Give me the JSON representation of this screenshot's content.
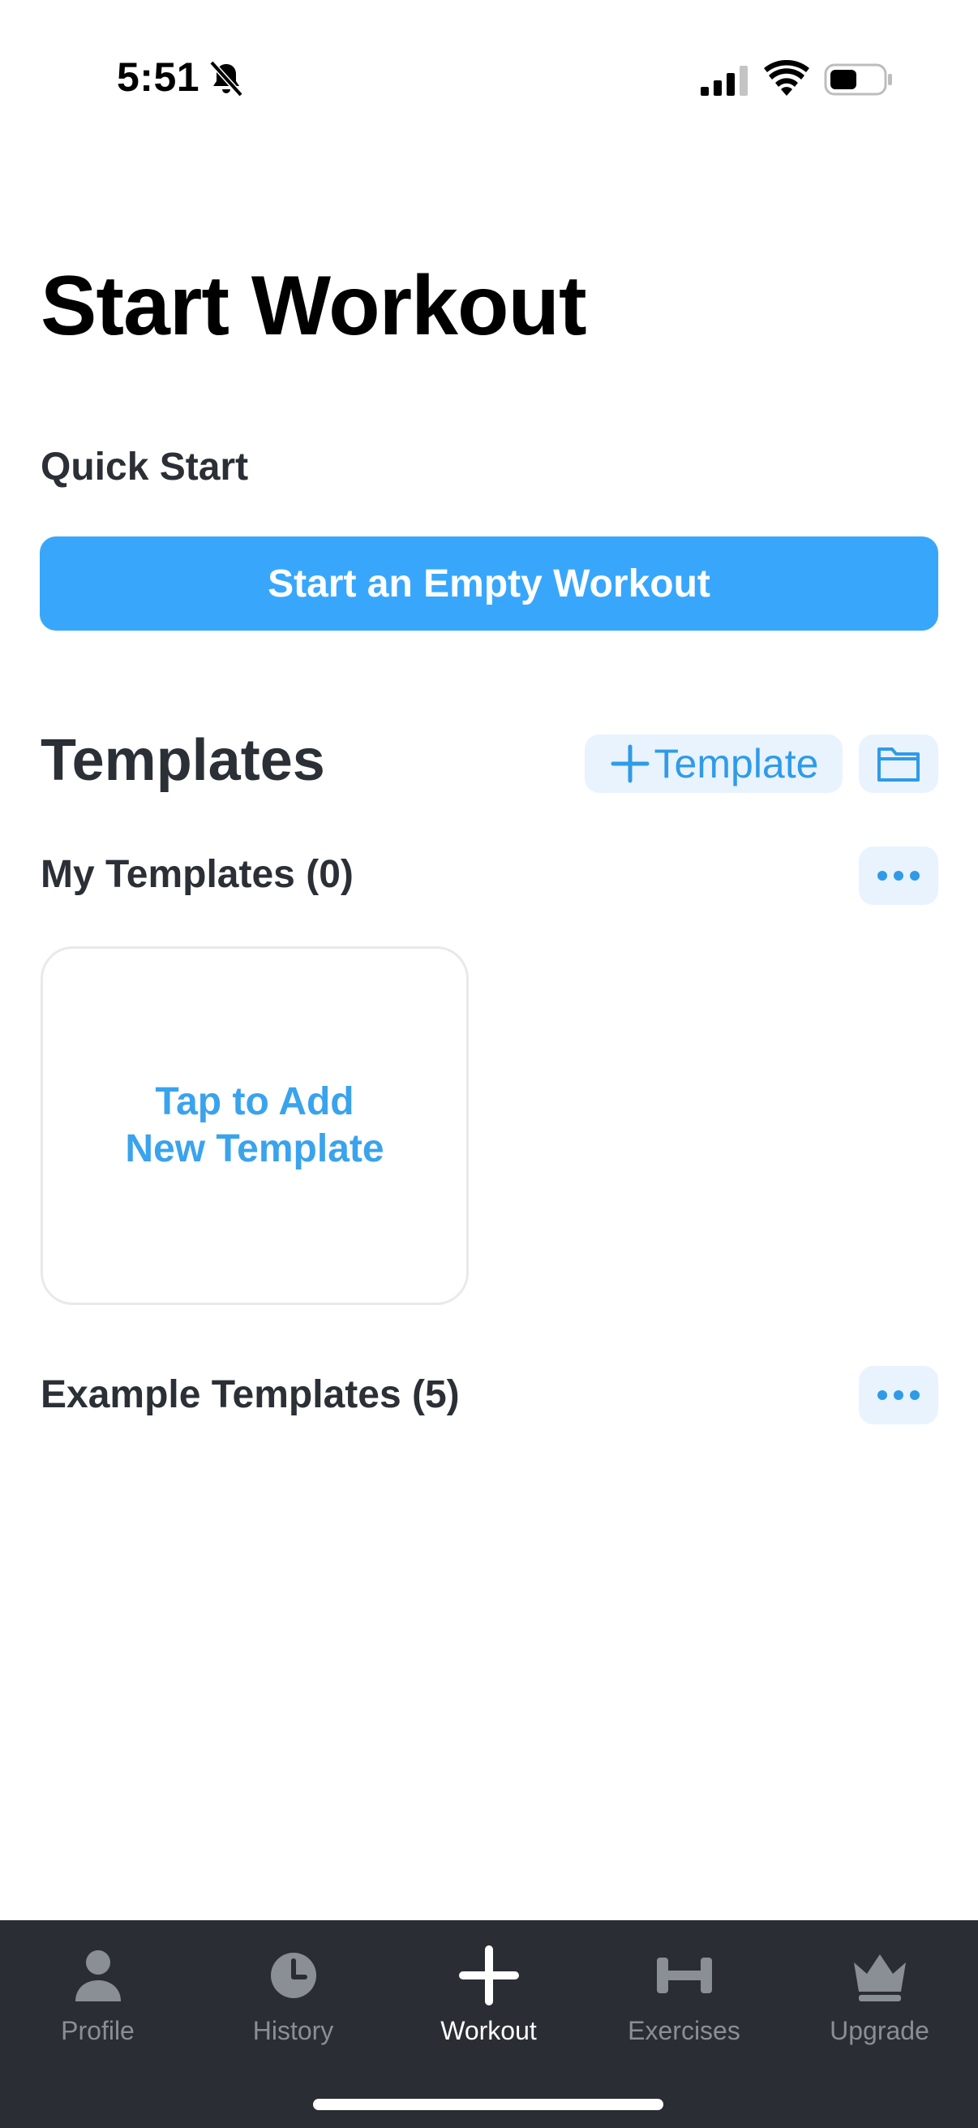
{
  "status_bar": {
    "time": "5:51",
    "icons": [
      "bell-muted-icon",
      "signal-icon",
      "wifi-icon",
      "battery-icon"
    ]
  },
  "page": {
    "title": "Start Workout"
  },
  "quick_start": {
    "label": "Quick Start",
    "button_label": "Start an Empty Workout"
  },
  "templates": {
    "heading": "Templates",
    "add_button_label": "Template",
    "my_templates_label": "My Templates (0)",
    "empty_card_line1": "Tap to Add",
    "empty_card_line2": "New Template",
    "example_templates_label": "Example Templates (5)"
  },
  "tab_bar": {
    "items": [
      {
        "label": "Profile",
        "icon": "person-icon"
      },
      {
        "label": "History",
        "icon": "clock-icon"
      },
      {
        "label": "Workout",
        "icon": "plus-icon"
      },
      {
        "label": "Exercises",
        "icon": "dumbbell-icon"
      },
      {
        "label": "Upgrade",
        "icon": "crown-icon"
      }
    ],
    "active": "Workout"
  },
  "colors": {
    "accent": "#38a7fb",
    "accent_text": "#2f9be8",
    "accent_soft_bg": "#e8f3fd",
    "tab_bar_bg": "#2a2d33",
    "tab_inactive": "#8a8e95"
  }
}
